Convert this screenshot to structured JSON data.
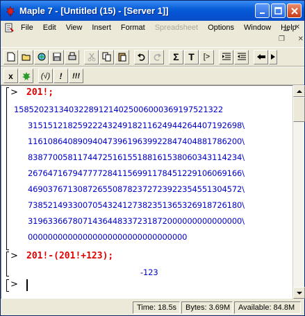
{
  "window": {
    "title": "Maple 7  - [Untitled (15) - [Server 1]]"
  },
  "menubar": {
    "items": [
      {
        "label": "File",
        "enabled": true
      },
      {
        "label": "Edit",
        "enabled": true
      },
      {
        "label": "View",
        "enabled": true
      },
      {
        "label": "Insert",
        "enabled": true
      },
      {
        "label": "Format",
        "enabled": true
      },
      {
        "label": "Spreadsheet",
        "enabled": false
      },
      {
        "label": "Options",
        "enabled": true
      },
      {
        "label": "Window",
        "enabled": true
      },
      {
        "label": "Help",
        "enabled": true
      }
    ]
  },
  "toolbar": {
    "sigma": "Σ",
    "text": "T",
    "math_input": "[>"
  },
  "contextbar": {
    "multiply": "x",
    "eval": "(√)",
    "bang": "!",
    "triple_bang": "!!!"
  },
  "worksheet": {
    "prompt": ">",
    "cmd1": "201!;",
    "output1": [
      "158520231340322891214025006000369197521322",
      "3151512182592224324918211624944264407192698\\",
      "1161086408909404739619639922847404881786200\\",
      "8387700581174472516155188161538060343114234\\",
      "2676471679477772841156991178451229106069166\\",
      "4690376713087265508782372723922354551304572\\",
      "7385214933007054324127382351365326918726180\\",
      "3196336678071436448337231872000000000000000\\",
      "00000000000000000000000000000000"
    ],
    "cmd2": "201!-(201!+123);",
    "output2": "-123"
  },
  "statusbar": {
    "time": "Time: 18.5s",
    "bytes": "Bytes: 3.69M",
    "available": "Available: 84.8M"
  }
}
